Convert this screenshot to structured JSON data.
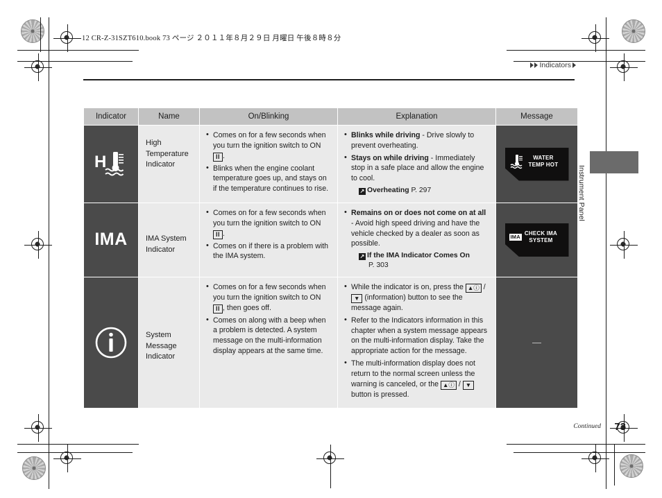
{
  "page": {
    "book_line": "12 CR-Z-31SZT610.book   73 ページ   ２０１１年８月２９日   月曜日   午後８時８分",
    "section_tag": "Indicators",
    "side_tab": "Instrument Panel",
    "footer_continued": "Continued",
    "page_number": "73"
  },
  "table": {
    "headers": [
      "Indicator",
      "Name",
      "On/Blinking",
      "Explanation",
      "Message"
    ],
    "rows": [
      {
        "icon_name": "high-temperature-icon",
        "icon_label": "H",
        "name": "High Temperature Indicator",
        "on_blinking": [
          "Comes on for a few seconds when you turn the ignition switch to ON |II|.",
          "Blinks when the engine coolant temperature goes up, and stays on if the temperature continues to rise."
        ],
        "explanation": [
          {
            "bold": "Blinks while driving",
            "rest": " - Drive slowly to prevent overheating."
          },
          {
            "bold": "Stays on while driving",
            "rest": " - Immediately stop in a safe place and allow the engine to cool."
          }
        ],
        "xref": {
          "title": "Overheating",
          "page": "P. 297"
        },
        "message": {
          "kind": "lcd",
          "icon": "coolant-temp-icon",
          "lines": [
            "WATER",
            "TEMP HOT"
          ]
        }
      },
      {
        "icon_name": "ima-system-icon",
        "icon_label": "IMA",
        "name": "IMA System Indicator",
        "on_blinking": [
          "Comes on for a few seconds when you turn the ignition switch to ON |II|.",
          "Comes on if there is a problem with the IMA system."
        ],
        "explanation": [
          {
            "bold": "Remains on or does not come on at all",
            "rest": " - Avoid high speed driving and have the vehicle checked by a dealer as soon as possible."
          }
        ],
        "xref": {
          "title": "If the IMA Indicator Comes On",
          "page": "P. 303"
        },
        "message": {
          "kind": "lcd",
          "icon": "ima-badge",
          "badge": "IMA",
          "lines": [
            "CHECK IMA",
            "SYSTEM"
          ]
        }
      },
      {
        "icon_name": "system-message-info-icon",
        "icon_label": "i",
        "name": "System Message Indicator",
        "on_blinking": [
          "Comes on for a few seconds when you turn the ignition switch to ON |II|, then goes off.",
          "Comes on along with a beep when a problem is detected. A system message on the multi-information display appears at the same time."
        ],
        "explanation": [
          {
            "bold": "",
            "rest": "While the indicator is on, press the |UP| / |DOWN| (information) button to see the message again."
          },
          {
            "bold": "",
            "rest": "Refer to the Indicators information in this chapter when a system message appears on the multi-information display. Take the appropriate action for the message."
          },
          {
            "bold": "",
            "rest": "The multi-information display does not return to the normal screen unless the warning is canceled, or the |UP| / |DOWN| button is pressed."
          }
        ],
        "xref": null,
        "message": {
          "kind": "dash",
          "text": "—"
        }
      }
    ]
  },
  "colors": {
    "header_bg": "#c2c2c2",
    "cell_bg": "#eaeaea",
    "icon_bg": "#4a4a4a",
    "lcd_bg": "#100f0f",
    "text": "#1d1d1d",
    "side_tab": "#6b6b6b"
  }
}
